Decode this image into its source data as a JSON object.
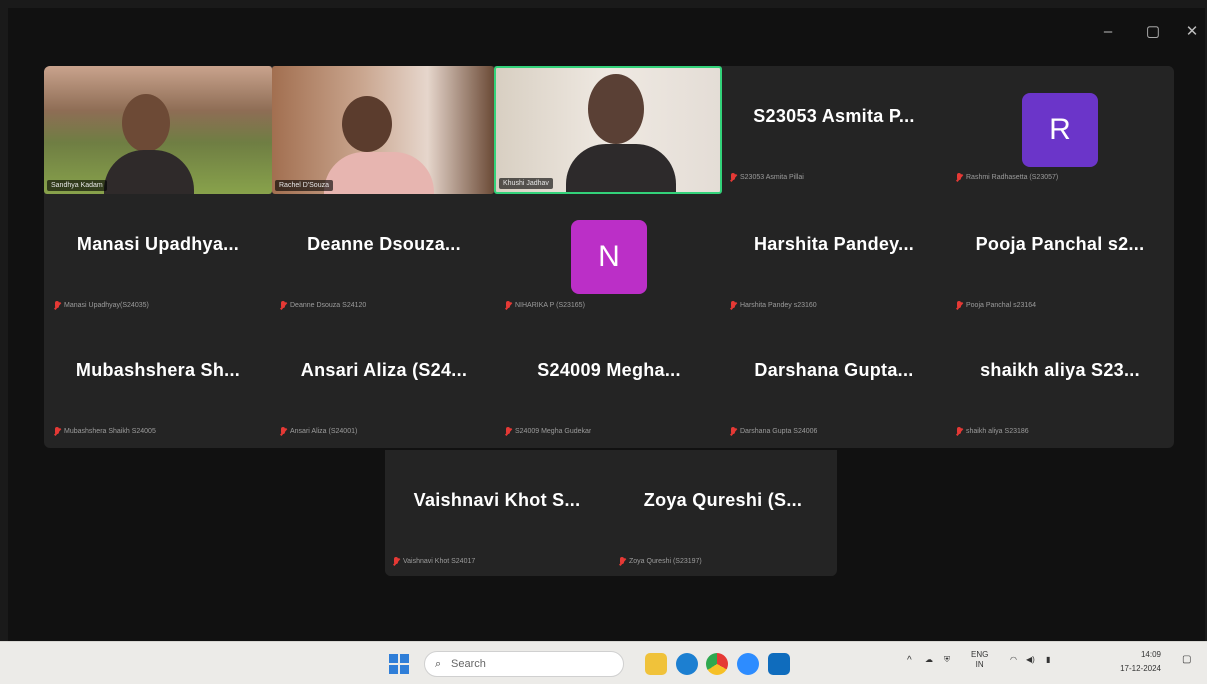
{
  "window": {
    "controls": {
      "minimize": "–",
      "maximize": "▢",
      "close": "✕"
    }
  },
  "video_tiles": [
    {
      "name_label": "Sandhya Kadam"
    },
    {
      "name_label": "Rachel D'Souza"
    },
    {
      "name_label": "Khushi Jadhav"
    }
  ],
  "tiles": [
    {
      "display_name": "S23053 Asmita P...",
      "subtitle": "S23053 Asmita Pillai"
    },
    {
      "avatar_letter": "R",
      "avatar_color": "#6b35c9",
      "subtitle": "Rashmi Radhasetta (S23057)"
    },
    {
      "display_name": "Manasi Upadhya...",
      "subtitle": "Manasi Upadhyay(S24035)"
    },
    {
      "display_name": "Deanne Dsouza...",
      "subtitle": "Deanne Dsouza S24120"
    },
    {
      "avatar_letter": "N",
      "avatar_color": "#bb2fc7",
      "subtitle": "NIHARIKA P (S23165)"
    },
    {
      "display_name": "Harshita Pandey...",
      "subtitle": "Harshita Pandey s23160"
    },
    {
      "display_name": "Pooja Panchal s2...",
      "subtitle": "Pooja Panchal s23164"
    },
    {
      "display_name": "Mubashshera Sh...",
      "subtitle": "Mubashshera Shaikh S24005"
    },
    {
      "display_name": "Ansari Aliza (S24...",
      "subtitle": "Ansari Aliza (S24001)"
    },
    {
      "display_name": "S24009 Megha...",
      "subtitle": "S24009 Megha Gudekar"
    },
    {
      "display_name": "Darshana Gupta...",
      "subtitle": "Darshana Gupta S24006"
    },
    {
      "display_name": "shaikh aliya S23...",
      "subtitle": "shaikh aliya S23186"
    },
    {
      "display_name": "Vaishnavi Khot S...",
      "subtitle": "Vaishnavi Khot S24017"
    },
    {
      "display_name": "Zoya Qureshi (S...",
      "subtitle": "Zoya Qureshi (S23197)"
    }
  ],
  "taskbar": {
    "search_placeholder": "Search",
    "search_icon": "search-icon",
    "apps": [
      "file-explorer-icon",
      "edge-icon",
      "chrome-icon",
      "zoom-icon",
      "outlook-icon"
    ],
    "tray": {
      "chevron": "^",
      "lang_top": "ENG",
      "lang_bottom": "IN"
    },
    "clock": {
      "time": "14:09",
      "date": "17-12-2024"
    }
  },
  "colors": {
    "tile_bg": "#242424",
    "active_speaker_border": "#33d27a",
    "muted_mic": "#e53935"
  }
}
